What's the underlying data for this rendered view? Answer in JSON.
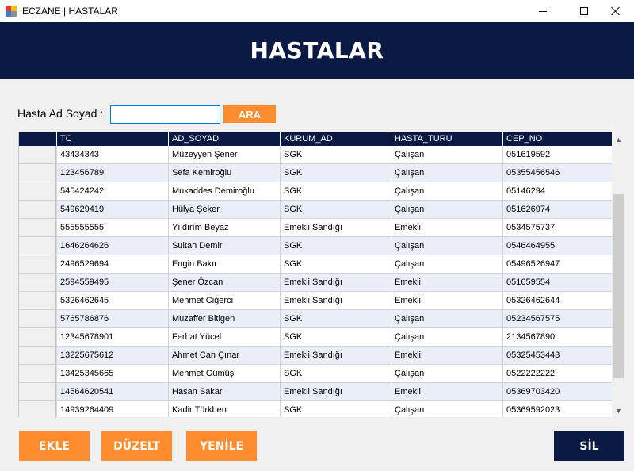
{
  "window": {
    "title": "ECZANE | HASTALAR",
    "minimize": "",
    "maximize": "",
    "close": ""
  },
  "header": {
    "title": "HASTALAR"
  },
  "search": {
    "label": "Hasta Ad Soyad :",
    "value": "",
    "button": "ARA"
  },
  "grid": {
    "columns": [
      "TC",
      "AD_SOYAD",
      "KURUM_AD",
      "HASTA_TURU",
      "CEP_NO"
    ],
    "rows": [
      [
        "43434343",
        "Müzeyyen Şener",
        "SGK",
        "Çalışan",
        "051619592"
      ],
      [
        "123456789",
        "Sefa Kemiroğlu",
        "SGK",
        "Çalışan",
        "05355456546"
      ],
      [
        "545424242",
        "Mukaddes Demiroğlu",
        "SGK",
        "Çalışan",
        "05146294"
      ],
      [
        "549629419",
        "Hülya Şeker",
        "SGK",
        "Çalışan",
        "051626974"
      ],
      [
        "555555555",
        "Yıldırım Beyaz",
        "Emekli Sandığı",
        "Emekli",
        "0534575737"
      ],
      [
        "1646264626",
        "Sultan Demir",
        "SGK",
        "Çalışan",
        "0546464955"
      ],
      [
        "2496529694",
        "Engin Bakır",
        "SGK",
        "Çalışan",
        "05496526947"
      ],
      [
        "2594559495",
        "Şener Özcan",
        "Emekli Sandığı",
        "Emekli",
        "051659554"
      ],
      [
        "5326462645",
        "Mehmet Ciğerci",
        "Emekli Sandığı",
        "Emekli",
        "05326462644"
      ],
      [
        "5765786876",
        "Muzaffer Bitigen",
        "SGK",
        "Çalışan",
        "05234567575"
      ],
      [
        "12345678901",
        "Ferhat Yücel",
        "SGK",
        "Çalışan",
        "2134567890"
      ],
      [
        "13225675612",
        "Ahmet Can Çınar",
        "Emekli Sandığı",
        "Emekli",
        "05325453443"
      ],
      [
        "13425345665",
        "Mehmet Gümüş",
        "SGK",
        "Çalışan",
        "0522222222"
      ],
      [
        "14564620541",
        "Hasan Sakar",
        "Emekli Sandığı",
        "Emekli",
        "05369703420"
      ],
      [
        "14939264409",
        "Kadir Türkben",
        "SGK",
        "Çalışan",
        "05369592023"
      ]
    ]
  },
  "buttons": {
    "ekle": "EKLE",
    "duzelt": "DÜZELT",
    "yenile": "YENİLE",
    "sil": "SİL"
  },
  "colors": {
    "header_bg": "#0b1a44",
    "accent": "#ff8c2e",
    "row_alt": "#eaeef9"
  }
}
